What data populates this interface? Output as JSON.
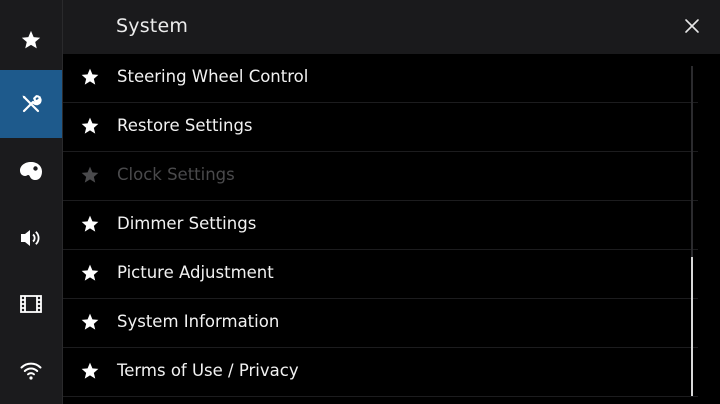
{
  "header": {
    "title": "System",
    "close_icon": "close-icon"
  },
  "sidebar": {
    "items": [
      {
        "name": "favorites",
        "icon": "star-icon",
        "active": false
      },
      {
        "name": "system",
        "icon": "tools-icon",
        "active": true
      },
      {
        "name": "theme",
        "icon": "palette-icon",
        "active": false
      },
      {
        "name": "audio",
        "icon": "speaker-icon",
        "active": false
      },
      {
        "name": "video",
        "icon": "film-icon",
        "active": false
      },
      {
        "name": "wireless",
        "icon": "wifi-icon",
        "active": false
      }
    ]
  },
  "list": {
    "items": [
      {
        "label": "Steering Wheel Control",
        "enabled": true
      },
      {
        "label": "Restore Settings",
        "enabled": true
      },
      {
        "label": "Clock Settings",
        "enabled": false
      },
      {
        "label": "Dimmer Settings",
        "enabled": true
      },
      {
        "label": "Picture Adjustment",
        "enabled": true
      },
      {
        "label": "System Information",
        "enabled": true
      },
      {
        "label": "Terms of Use / Privacy",
        "enabled": true
      }
    ]
  },
  "scrollbar": {
    "position_fraction": 0.58,
    "visible_fraction": 0.42
  },
  "colors": {
    "accent": "#1e5a8c",
    "background": "#000000",
    "header": "#1a1a1c",
    "sidebar": "#1b1b1d",
    "disabled_text": "#4a4a4c"
  }
}
